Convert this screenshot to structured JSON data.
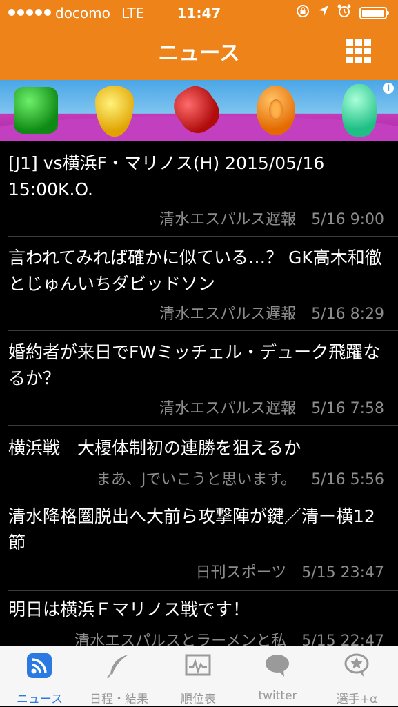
{
  "status_bar": {
    "carrier": "docomo",
    "network": "LTE",
    "time": "11:47"
  },
  "header": {
    "title": "ニュース",
    "menu_icon": "grid-icon",
    "background_color": "#ee8419"
  },
  "ad_banner": {
    "info_label": "i"
  },
  "news": [
    {
      "title": "[J1] vs横浜F・マリノス(H) 2015/05/16 15:00K.O.",
      "source": "清水エスパルス遅報",
      "time": "5/16 9:00"
    },
    {
      "title": "言われてみれば確かに似ている…？ GK高木和徹とじゅんいちダビッドソン",
      "source": "清水エスパルス遅報",
      "time": "5/16 8:29"
    },
    {
      "title": "婚約者が来日でFWミッチェル・デューク飛躍なるか？",
      "source": "清水エスパルス遅報",
      "time": "5/16 7:58"
    },
    {
      "title": "横浜戦　大榎体制初の連勝を狙えるか",
      "source": "まあ、Jでいこうと思います。",
      "time": "5/16 5:56"
    },
    {
      "title": "清水降格圏脱出へ大前ら攻撃陣が鍵／清ー横12節",
      "source": "日刊スポーツ",
      "time": "5/15 23:47"
    },
    {
      "title": "明日は横浜Ｆマリノス戦です！",
      "source": "清水エスパルスとラーメンと私",
      "time": "5/15 22:47"
    }
  ],
  "tabs": [
    {
      "label": "ニュース",
      "icon": "rss-icon",
      "active": true
    },
    {
      "label": "日程・結果",
      "icon": "feather-icon",
      "active": false
    },
    {
      "label": "順位表",
      "icon": "chart-icon",
      "active": false
    },
    {
      "label": "twitter",
      "icon": "speech-bubble-icon",
      "active": false
    },
    {
      "label": "選手+α",
      "icon": "star-bubble-icon",
      "active": false
    }
  ],
  "colors": {
    "accent": "#ee8419",
    "active_tab": "#2a7ae2",
    "meta_text": "#8c8c8c"
  }
}
